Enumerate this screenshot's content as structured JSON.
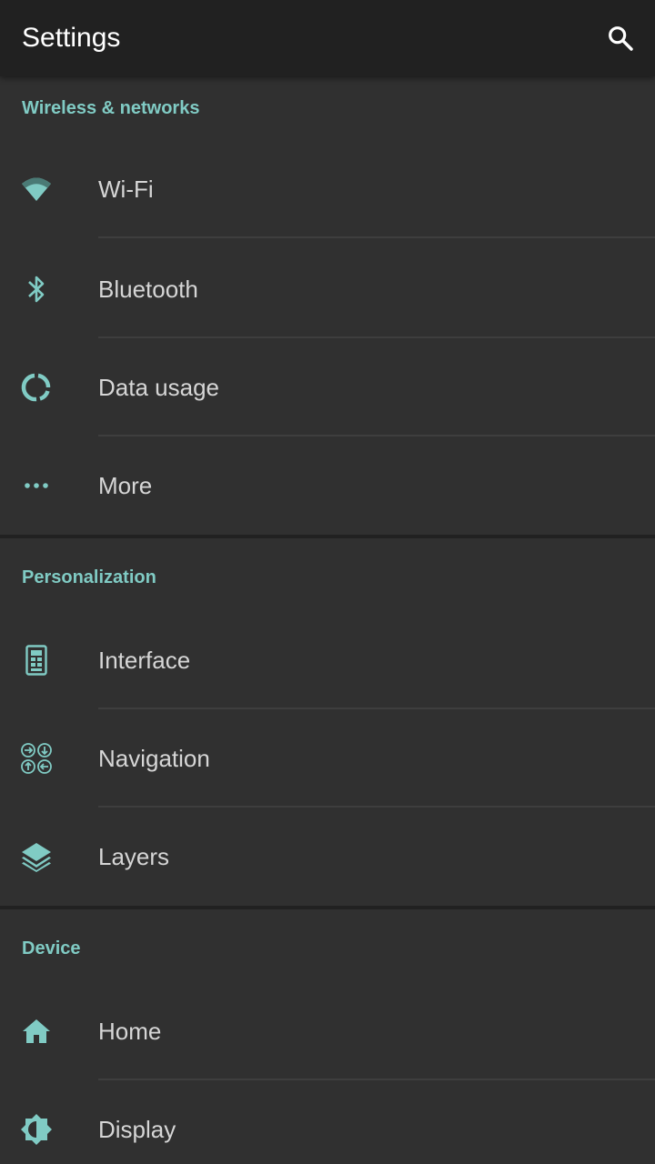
{
  "appbar": {
    "title": "Settings",
    "search_icon": "search-icon"
  },
  "colors": {
    "accent": "#80cbc4",
    "background": "#303030",
    "appbar": "#212121",
    "text": "#d6d6d6"
  },
  "sections": [
    {
      "header": "Wireless & networks",
      "items": [
        {
          "label": "Wi-Fi",
          "icon": "wifi-icon"
        },
        {
          "label": "Bluetooth",
          "icon": "bluetooth-icon"
        },
        {
          "label": "Data usage",
          "icon": "data-usage-icon"
        },
        {
          "label": "More",
          "icon": "more-icon"
        }
      ]
    },
    {
      "header": "Personalization",
      "items": [
        {
          "label": "Interface",
          "icon": "interface-icon"
        },
        {
          "label": "Navigation",
          "icon": "navigation-icon"
        },
        {
          "label": "Layers",
          "icon": "layers-icon"
        }
      ]
    },
    {
      "header": "Device",
      "items": [
        {
          "label": "Home",
          "icon": "home-icon"
        },
        {
          "label": "Display",
          "icon": "display-icon"
        }
      ]
    }
  ]
}
